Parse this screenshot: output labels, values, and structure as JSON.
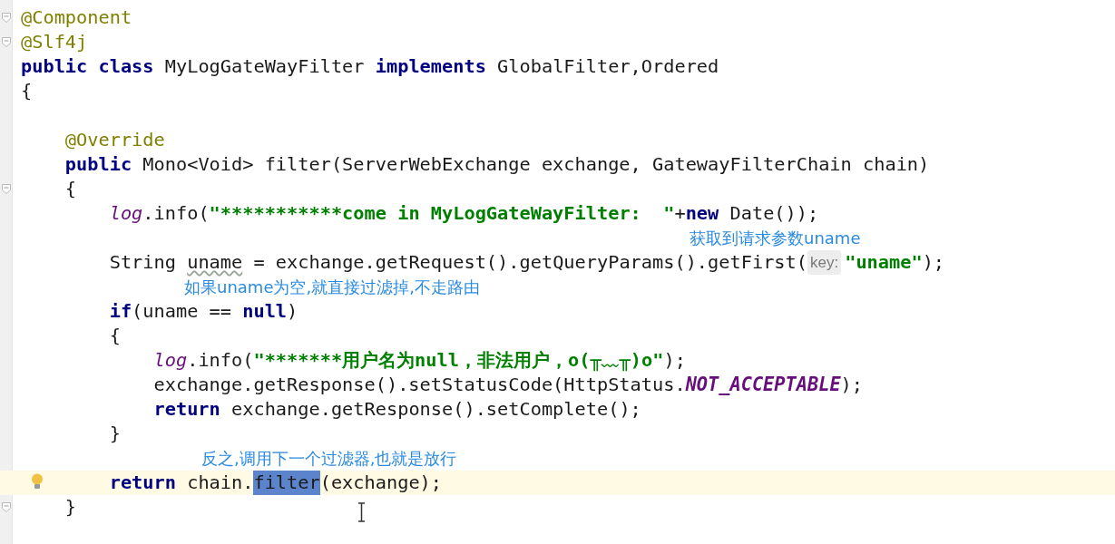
{
  "editor": {
    "lines": [
      {
        "kind": "code",
        "fold": true,
        "tokens": [
          {
            "kind": "annotation",
            "text": "@Component"
          }
        ]
      },
      {
        "kind": "code",
        "fold": true,
        "tokens": [
          {
            "kind": "annotation",
            "text": "@Slf4j"
          }
        ]
      },
      {
        "kind": "code",
        "tokens": [
          {
            "kind": "keyword",
            "text": "public class "
          },
          {
            "kind": "plain",
            "text": "MyLogGateWayFilter "
          },
          {
            "kind": "keyword",
            "text": "implements "
          },
          {
            "kind": "plain",
            "text": "GlobalFilter,Ordered"
          }
        ]
      },
      {
        "kind": "code",
        "tokens": [
          {
            "kind": "plain",
            "text": "{"
          }
        ]
      },
      {
        "kind": "blank"
      },
      {
        "kind": "code",
        "tokens": [
          {
            "kind": "annotation",
            "text": "    @Override"
          }
        ]
      },
      {
        "kind": "code",
        "tokens": [
          {
            "kind": "keyword",
            "text": "    public "
          },
          {
            "kind": "plain",
            "text": "Mono<Void> filter(ServerWebExchange exchange, GatewayFilterChain chain)"
          }
        ]
      },
      {
        "kind": "code",
        "fold": true,
        "tokens": [
          {
            "kind": "plain",
            "text": "    {"
          }
        ]
      },
      {
        "kind": "code",
        "tokens": [
          {
            "kind": "field",
            "text": "        log"
          },
          {
            "kind": "plain",
            "text": ".info("
          },
          {
            "kind": "string",
            "text": "\"***********come in MyLogGateWayFilter:  \""
          },
          {
            "kind": "plain",
            "text": "+"
          },
          {
            "kind": "keyword",
            "text": "new "
          },
          {
            "kind": "plain",
            "text": "Date());"
          }
        ]
      },
      {
        "kind": "note",
        "note": "获取到请求参数uname"
      },
      {
        "kind": "code",
        "tokens": [
          {
            "kind": "plain",
            "text": "        String "
          },
          {
            "kind": "underlined",
            "text": "uname"
          },
          {
            "kind": "plain",
            "text": " = exchange.getRequest().getQueryParams().getFirst("
          },
          {
            "kind": "hint",
            "text": "key:"
          },
          {
            "kind": "string",
            "text": "\"uname\""
          },
          {
            "kind": "plain",
            "text": ");"
          }
        ]
      },
      {
        "kind": "note",
        "note": "如果uname为空,就直接过滤掉,不走路由"
      },
      {
        "kind": "code",
        "tokens": [
          {
            "kind": "keyword",
            "text": "        if"
          },
          {
            "kind": "plain",
            "text": "(uname == "
          },
          {
            "kind": "keyword",
            "text": "null"
          },
          {
            "kind": "plain",
            "text": ")"
          }
        ]
      },
      {
        "kind": "code",
        "tokens": [
          {
            "kind": "plain",
            "text": "        {"
          }
        ]
      },
      {
        "kind": "code",
        "tokens": [
          {
            "kind": "field",
            "text": "            log"
          },
          {
            "kind": "plain",
            "text": ".info("
          },
          {
            "kind": "string",
            "text": "\"*******用户名为null，非法用户，o(╥﹏╥)o\""
          },
          {
            "kind": "plain",
            "text": ");"
          }
        ]
      },
      {
        "kind": "code",
        "tokens": [
          {
            "kind": "plain",
            "text": "            exchange.getResponse().setStatusCode(HttpStatus."
          },
          {
            "kind": "constant",
            "text": "NOT_ACCEPTABLE"
          },
          {
            "kind": "plain",
            "text": ");"
          }
        ]
      },
      {
        "kind": "code",
        "tokens": [
          {
            "kind": "keyword",
            "text": "            return "
          },
          {
            "kind": "plain",
            "text": "exchange.getResponse().setComplete();"
          }
        ]
      },
      {
        "kind": "code",
        "tokens": [
          {
            "kind": "plain",
            "text": "        }"
          }
        ]
      },
      {
        "kind": "note",
        "note": "反之,调用下一个过滤器,也就是放行"
      },
      {
        "kind": "code",
        "current": true,
        "tokens": [
          {
            "kind": "keyword",
            "text": "        return "
          },
          {
            "kind": "plain",
            "text": "chain."
          },
          {
            "kind": "selection",
            "text": "filter"
          },
          {
            "kind": "plain",
            "text": "(exchange);"
          }
        ]
      },
      {
        "kind": "code",
        "fold": true,
        "tokens": [
          {
            "kind": "plain",
            "text": "    }"
          }
        ]
      }
    ]
  }
}
